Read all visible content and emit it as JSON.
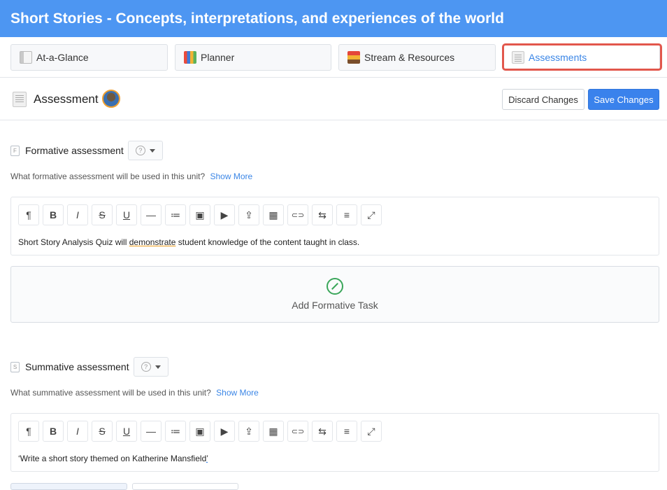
{
  "unit_title": "Short Stories - Concepts, interpretations, and experiences of the world",
  "tabs": [
    {
      "label": "At-a-Glance",
      "icon": "glance-icon"
    },
    {
      "label": "Planner",
      "icon": "books-icon"
    },
    {
      "label": "Stream & Resources",
      "icon": "stream-icon"
    },
    {
      "label": "Assessments",
      "icon": "document-icon",
      "active": true
    }
  ],
  "header": {
    "title": "Assessment",
    "discard_label": "Discard Changes",
    "save_label": "Save Changes"
  },
  "formative": {
    "title": "Formative assessment",
    "icon_letter": "F",
    "prompt": "What formative assessment will be used in this unit?",
    "show_more": "Show More",
    "content_before": "Short Story Analysis Quiz will ",
    "content_flagged": "demonstrate",
    "content_after": " student knowledge of the content taught in class.",
    "add_task_label": "Add Formative Task"
  },
  "summative": {
    "title": "Summative assessment",
    "icon_letter": "S",
    "prompt": "What summative assessment will be used in this unit?",
    "show_more": "Show More",
    "content_main": "‘Write a short story themed on Katherine Mansfield",
    "content_flagged": "’"
  },
  "toolbar_buttons": [
    "¶",
    "B",
    "I",
    "S",
    "U",
    "—",
    "≔",
    "▣",
    "▶",
    "⇪",
    "▦",
    "⊂⊃",
    "⇆",
    "≡",
    "⤢"
  ],
  "colors": {
    "topbar": "#4d96f2",
    "accent": "#3a82ec",
    "highlight": "#e2574c",
    "add_task": "#3aa65a"
  }
}
